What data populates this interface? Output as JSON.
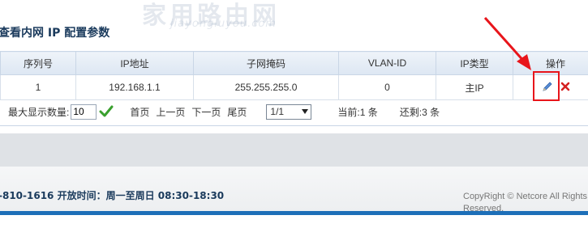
{
  "panel": {
    "title": "查看内网 IP 配置参数"
  },
  "table": {
    "headers": [
      "序列号",
      "IP地址",
      "子网掩码",
      "VLAN-ID",
      "IP类型",
      "操作"
    ],
    "rows": [
      {
        "seq": "1",
        "ip": "192.168.1.1",
        "mask": "255.255.255.0",
        "vlan": "0",
        "type": "主IP"
      }
    ]
  },
  "pager": {
    "page_size_label": "最大显示数量:",
    "page_size_value": "10",
    "first": "首页",
    "prev": "上一页",
    "next": "下一页",
    "last": "尾页",
    "page_select": "1/1",
    "current": "当前:1 条",
    "remaining": "还剩:3 条"
  },
  "footer": {
    "hotline": "-810-1616  开放时间：周一至周日 08:30-18:30",
    "copyright": "CopyRight © Netcore All Rights Reserved."
  },
  "watermark": {
    "cn": "家用路由网",
    "en": "jiayongluyou.com"
  },
  "icons": {
    "confirm": "check-icon",
    "edit": "pencil-icon",
    "delete": "close-icon",
    "dropdown": "caret-down-icon"
  },
  "colors": {
    "highlight": "#e8151b",
    "accent_blue": "#1d6fb8",
    "confirm_green": "#3aa02e",
    "delete_red": "#d42020"
  }
}
